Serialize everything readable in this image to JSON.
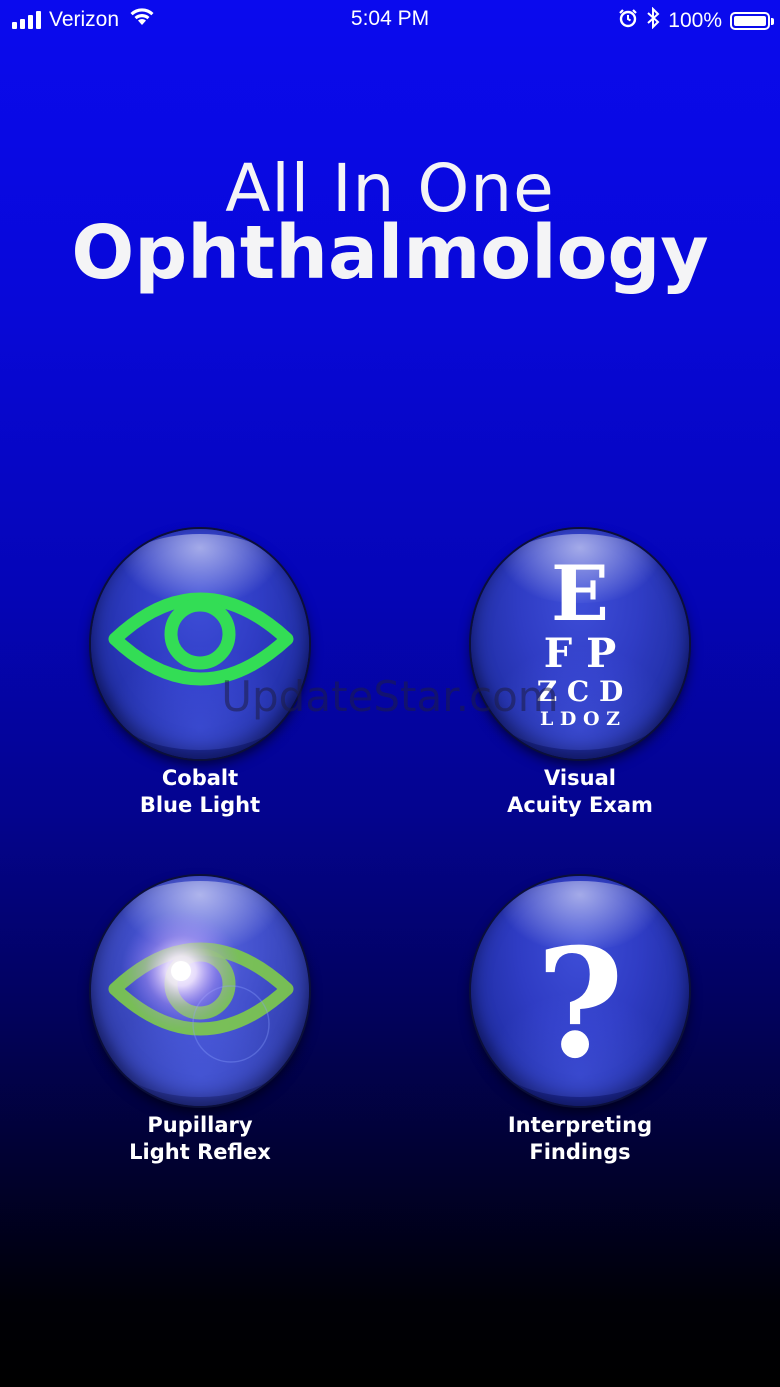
{
  "status_bar": {
    "carrier": "Verizon",
    "time": "5:04 PM",
    "battery_percent": "100%",
    "battery_level": 1.0,
    "signal_bars": 4,
    "icons": [
      "signal-icon",
      "wifi-icon",
      "alarm-icon",
      "bluetooth-icon",
      "battery-icon"
    ]
  },
  "title": {
    "line1": "All In One",
    "line2": "Ophthalmology"
  },
  "tiles": [
    {
      "icon": "eye-icon",
      "icon_color": "#33dd55",
      "label_line1": "Cobalt",
      "label_line2": "Blue Light"
    },
    {
      "icon": "eye-chart-icon",
      "chart_rows": [
        "E",
        "F P",
        "Z C D",
        "L D O Z"
      ],
      "label_line1": "Visual",
      "label_line2": "Acuity Exam"
    },
    {
      "icon": "eye-with-light-flare-icon",
      "icon_color": "#7ecb4a",
      "label_line1": "Pupillary",
      "label_line2": "Light Reflex"
    },
    {
      "icon": "question-mark-icon",
      "symbol": "?",
      "label_line1": "Interpreting",
      "label_line2": "Findings"
    }
  ],
  "watermark": "UpdateStar.com",
  "colors": {
    "background_top": "#0a0aee",
    "background_bottom": "#000000",
    "orb": "#2f3cc4",
    "text": "#ffffff"
  }
}
